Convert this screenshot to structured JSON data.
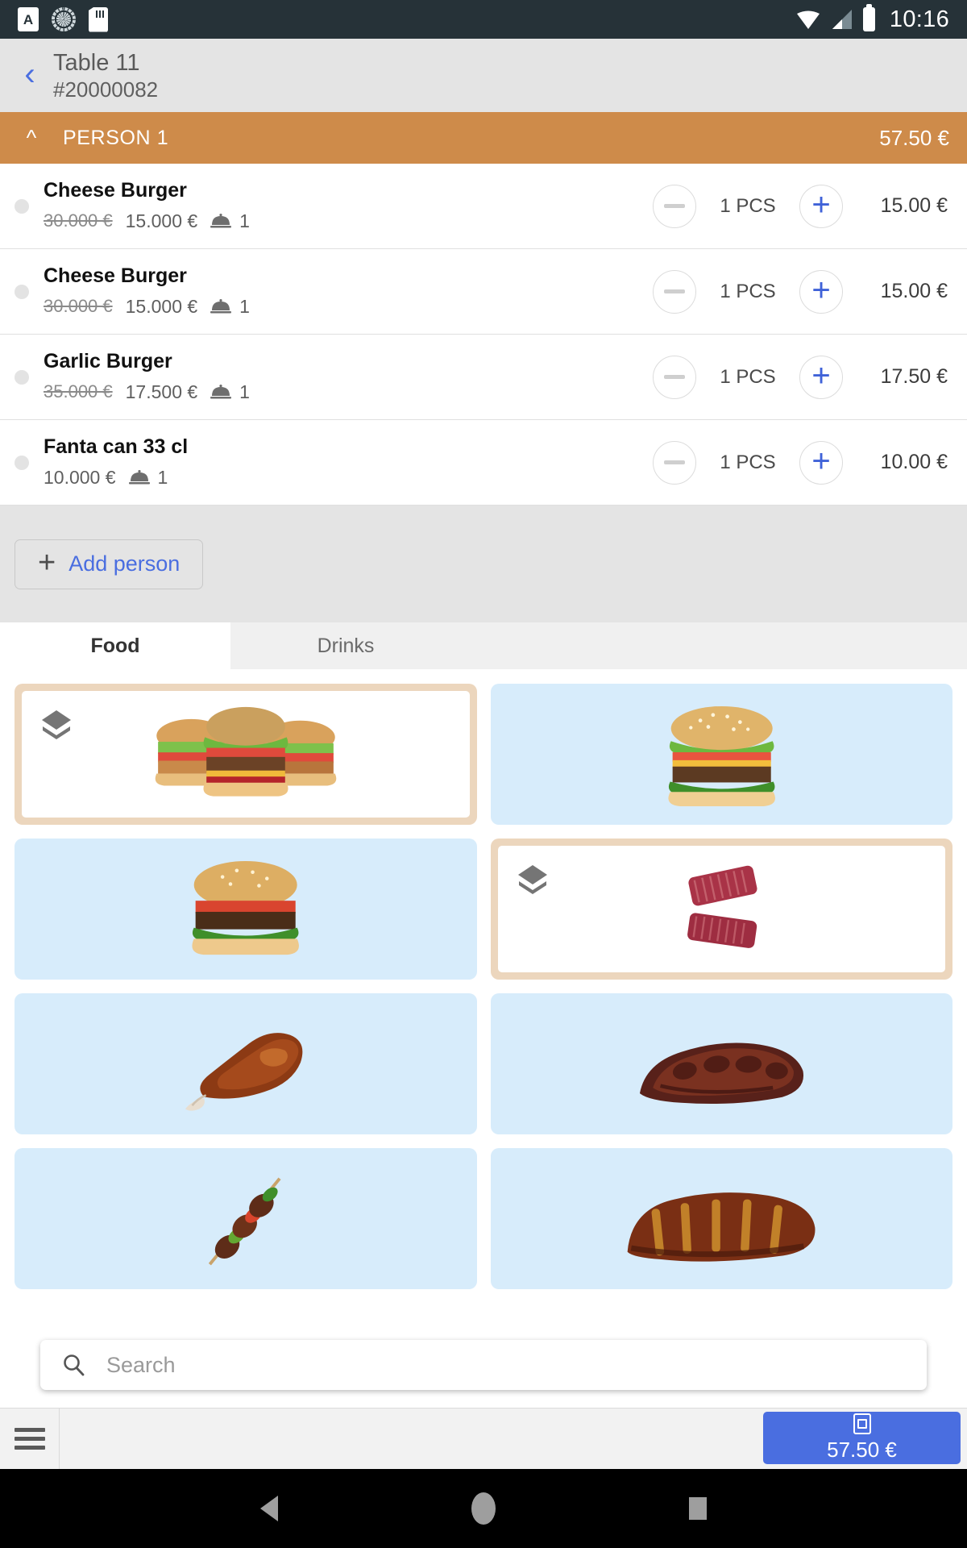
{
  "statusbar": {
    "icons": [
      "abc-keyboard-icon",
      "sync-ring-icon",
      "sd-card-icon",
      "wifi-icon",
      "signal-icon",
      "battery-icon"
    ],
    "time": "10:16"
  },
  "order_header": {
    "back_icon": "chevron-left-icon",
    "table_title": "Table 11",
    "order_number": "#20000082"
  },
  "person": {
    "collapse_icon": "chevron-up-icon",
    "label": "PERSON 1",
    "total": "57.50 €",
    "bar_color": "#ce8b4a"
  },
  "items": [
    {
      "name": "Cheese Burger",
      "price_original": "30.000 €",
      "price_current": "15.000 €",
      "course_icon": "cloche-icon",
      "course": "1",
      "minus_label": "−",
      "quantity": "1 PCS",
      "plus_label": "+",
      "line_total": "15.00 €"
    },
    {
      "name": "Cheese Burger",
      "price_original": "30.000 €",
      "price_current": "15.000 €",
      "course_icon": "cloche-icon",
      "course": "1",
      "minus_label": "−",
      "quantity": "1 PCS",
      "plus_label": "+",
      "line_total": "15.00 €"
    },
    {
      "name": "Garlic Burger",
      "price_original": "35.000 €",
      "price_current": "17.500 €",
      "course_icon": "cloche-icon",
      "course": "1",
      "minus_label": "−",
      "quantity": "1 PCS",
      "plus_label": "+",
      "line_total": "17.50 €"
    },
    {
      "name": "Fanta can 33 cl",
      "price_original": "",
      "price_current": "10.000 €",
      "course_icon": "cloche-icon",
      "course": "1",
      "minus_label": "−",
      "quantity": "1 PCS",
      "plus_label": "+",
      "line_total": "10.00 €"
    }
  ],
  "add_person": {
    "plus_icon": "plus-icon",
    "label": "Add person"
  },
  "tabs": [
    {
      "label": "Food",
      "active": true
    },
    {
      "label": "Drinks",
      "active": false
    }
  ],
  "products": [
    {
      "kind": "category",
      "name": "burger-trio-category",
      "art": "burger-trio",
      "badge_icon": "layers-icon"
    },
    {
      "kind": "product",
      "name": "cheese-burger-tile",
      "art": "cheeseburger",
      "badge_icon": ""
    },
    {
      "kind": "product",
      "name": "tomato-burger-tile",
      "art": "tomato-burger",
      "badge_icon": ""
    },
    {
      "kind": "category",
      "name": "raw-meat-category",
      "art": "raw-steaks",
      "badge_icon": "layers-icon"
    },
    {
      "kind": "product",
      "name": "roast-chicken-tile",
      "art": "chicken-leg",
      "badge_icon": ""
    },
    {
      "kind": "product",
      "name": "bbq-ribs-tile",
      "art": "bbq-ribs",
      "badge_icon": ""
    },
    {
      "kind": "product",
      "name": "meat-skewer-tile",
      "art": "skewer",
      "badge_icon": ""
    },
    {
      "kind": "product",
      "name": "grilled-ribs-tile",
      "art": "grilled-ribs",
      "badge_icon": ""
    }
  ],
  "search": {
    "icon": "search-icon",
    "placeholder": "Search",
    "value": ""
  },
  "bottombar": {
    "menu_icon": "hamburger-menu-icon",
    "pay_icon": "card-reader-icon",
    "pay_amount": "57.50 €",
    "pay_color": "#4a6ee0"
  },
  "navbar": {
    "back_icon": "nav-back-icon",
    "home_icon": "nav-home-icon",
    "recents_icon": "nav-recents-icon"
  },
  "colors": {
    "accent_blue": "#4a6ee0",
    "person_orange": "#ce8b4a",
    "tile_blue": "#d7ecfb",
    "category_peach": "#ecd6bd",
    "panel_gray": "#e4e4e4",
    "statusbar_dark": "#263238"
  }
}
